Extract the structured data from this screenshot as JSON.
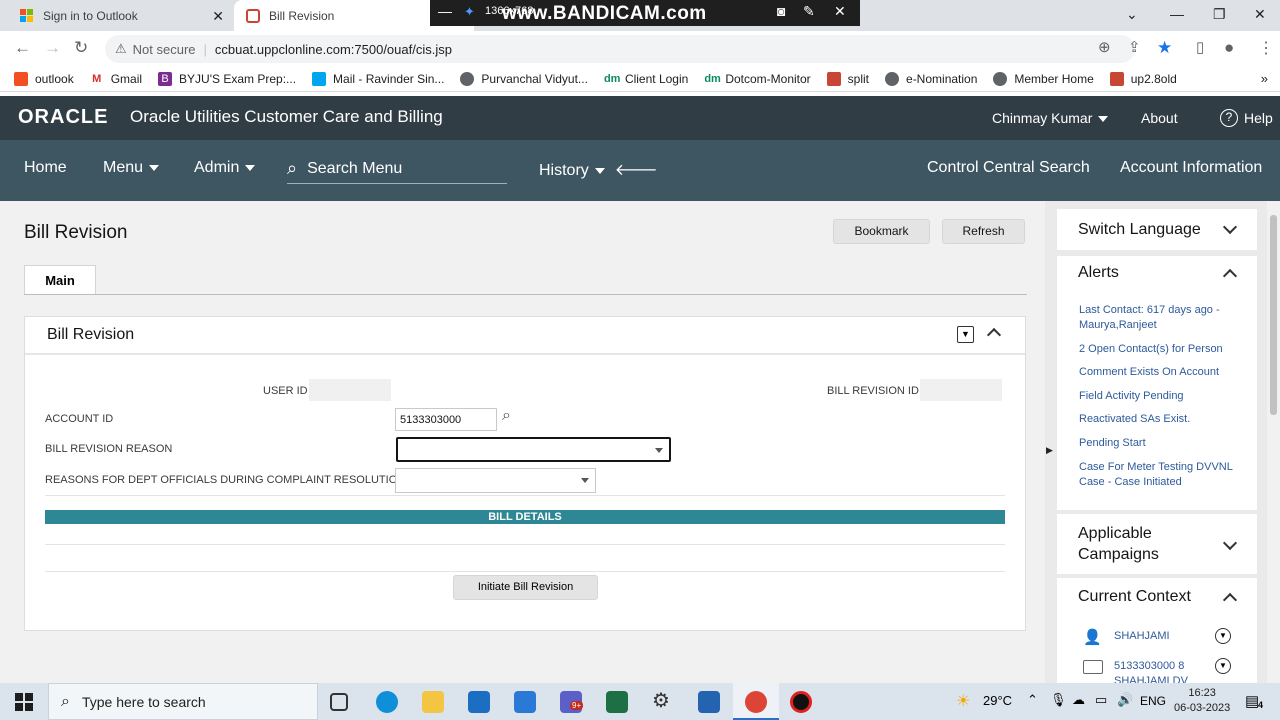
{
  "browser": {
    "tabs": [
      {
        "title": "Sign in to Outlook"
      },
      {
        "title": "Bill Revision"
      }
    ],
    "security": "Not secure",
    "url": "ccbuat.uppclonline.com:7500/ouaf/cis.jsp",
    "bookmarks": [
      "outlook",
      "Gmail",
      "BYJU'S Exam Prep:...",
      "Mail - Ravinder Sin...",
      "Purvanchal Vidyut...",
      "Client Login",
      "Dotcom-Monitor",
      "split",
      "e-Nomination",
      "Member Home",
      "up2.8old"
    ]
  },
  "recorder": {
    "resolution": "1366x768",
    "watermark": "www.BANDICAM.com"
  },
  "app": {
    "logo": "ORACLE",
    "title": "Oracle Utilities Customer Care and Billing",
    "user": "Chinmay Kumar",
    "about": "About",
    "help": "Help"
  },
  "nav": {
    "home": "Home",
    "menu": "Menu",
    "admin": "Admin",
    "search_placeholder": "Search Menu",
    "history": "History",
    "control_central": "Control Central Search",
    "account_info": "Account Information"
  },
  "page": {
    "title": "Bill Revision",
    "bookmark_btn": "Bookmark",
    "refresh_btn": "Refresh",
    "tab_main": "Main",
    "panel_title": "Bill Revision",
    "fields": {
      "user_id_label": "USER ID",
      "user_id_value": "",
      "bill_revision_id_label": "BILL REVISION ID",
      "bill_revision_id_value": "",
      "account_id_label": "ACCOUNT ID",
      "account_id_value": "5133303000",
      "reason_label": "BILL REVISION REASON",
      "reason_value": "",
      "dept_reason_label": "REASONS FOR DEPT OFFICIALS DURING COMPLAINT RESOLUTION",
      "dept_reason_value": ""
    },
    "bill_details": "BILL DETAILS",
    "initiate_btn": "Initiate Bill Revision"
  },
  "sidebar": {
    "switch_language": "Switch Language",
    "alerts_title": "Alerts",
    "alerts": [
      "Last Contact: 617 days ago - Maurya,Ranjeet",
      "2 Open Contact(s) for Person",
      "Comment Exists On Account",
      "Field Activity Pending",
      "Reactivated SAs Exist.",
      "Pending Start",
      "Case For Meter Testing DVVNL Case - Case Initiated"
    ],
    "campaigns": "Applicable Campaigns",
    "current_context": "Current Context",
    "context_person": "SHAHJAMI",
    "context_account": "5133303000 8 SHAHJAMI DV"
  },
  "taskbar": {
    "search_placeholder": "Type here to search",
    "teams_badge": "9+",
    "temperature": "29°C",
    "language": "ENG",
    "time": "16:23",
    "date": "06-03-2023",
    "notifications": "4"
  }
}
